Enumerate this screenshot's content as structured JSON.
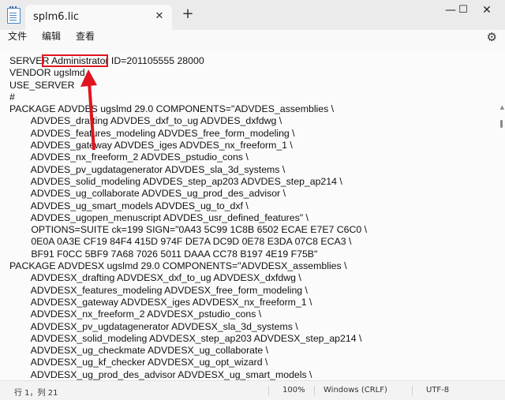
{
  "tab": {
    "title": "splm6.lic",
    "close_glyph": "✕"
  },
  "new_tab_glyph": "+",
  "window_buttons": {
    "minimize": "—",
    "maximize": "☐",
    "close": "✕"
  },
  "menu": {
    "file": "文件",
    "edit": "编辑",
    "view": "查看"
  },
  "settings_icon": "gear-icon",
  "lines": [
    "SERVER Administrator ID=201105555 28000",
    "VENDOR ugslmd",
    "USE_SERVER",
    "#",
    "PACKAGE ADVDES ugslmd 29.0 COMPONENTS=\"ADVDES_assemblies \\",
    "        ADVDES_drafting ADVDES_dxf_to_ug ADVDES_dxfdwg \\",
    "        ADVDES_features_modeling ADVDES_free_form_modeling \\",
    "        ADVDES_gateway ADVDES_iges ADVDES_nx_freeform_1 \\",
    "        ADVDES_nx_freeform_2 ADVDES_pstudio_cons \\",
    "        ADVDES_pv_ugdatagenerator ADVDES_sla_3d_systems \\",
    "        ADVDES_solid_modeling ADVDES_step_ap203 ADVDES_step_ap214 \\",
    "        ADVDES_ug_collaborate ADVDES_ug_prod_des_advisor \\",
    "        ADVDES_ug_smart_models ADVDES_ug_to_dxf \\",
    "        ADVDES_ugopen_menuscript ADVDES_usr_defined_features\" \\",
    "        OPTIONS=SUITE ck=199 SIGN=\"0A43 5C99 1C8B 6502 ECAE E7E7 C6C0 \\",
    "        0E0A 0A3E CF19 84F4 415D 974F DE7A DC9D 0E78 E3DA 07C8 ECA3 \\",
    "        BF91 F0CC 5BF9 7A68 7026 5011 DAAA CC78 B197 4E19 F75B\"",
    "PACKAGE ADVDESX ugslmd 29.0 COMPONENTS=\"ADVDESX_assemblies \\",
    "        ADVDESX_drafting ADVDESX_dxf_to_ug ADVDESX_dxfdwg \\",
    "        ADVDESX_features_modeling ADVDESX_free_form_modeling \\",
    "        ADVDESX_gateway ADVDESX_iges ADVDESX_nx_freeform_1 \\",
    "        ADVDESX_nx_freeform_2 ADVDESX_pstudio_cons \\",
    "        ADVDESX_pv_ugdatagenerator ADVDESX_sla_3d_systems \\",
    "        ADVDESX_solid_modeling ADVDESX_step_ap203 ADVDESX_step_ap214 \\",
    "        ADVDESX_ug_checkmate ADVDESX_ug_collaborate \\",
    "        ADVDESX_ug_kf_checker ADVDESX_ug_opt_wizard \\",
    "        ADVDESX_ug_prod_des_advisor ADVDESX_ug_smart_models \\"
  ],
  "annotation": {
    "highlight_color": "#e0141e"
  },
  "status": {
    "position": "行 1，列 21",
    "zoom": "100%",
    "line_ending": "Windows (CRLF)",
    "encoding": "UTF-8"
  }
}
